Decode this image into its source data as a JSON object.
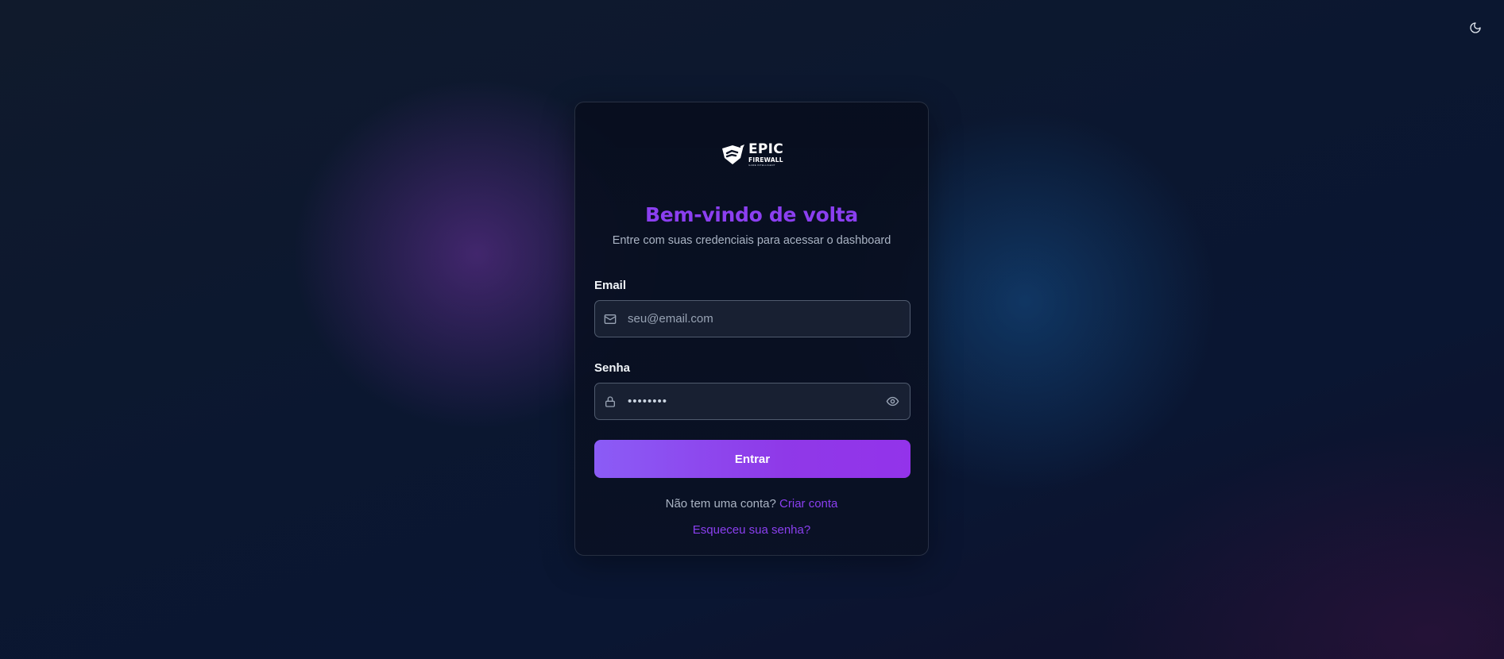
{
  "brand": {
    "name": "EPIC",
    "name_line2": "FIREWALL",
    "tagline": "GAME INTELLIGENT"
  },
  "header": {
    "theme_toggle_icon": "moon-icon"
  },
  "login": {
    "title": "Bem-vindo de volta",
    "subtitle": "Entre com suas credenciais para acessar o dashboard",
    "email": {
      "label": "Email",
      "placeholder": "seu@email.com",
      "value": "",
      "icon": "mail-icon"
    },
    "password": {
      "label": "Senha",
      "value": "••••••••",
      "icon": "lock-icon",
      "toggle_icon": "eye-icon"
    },
    "submit_label": "Entrar",
    "no_account_text": "Não tem uma conta?",
    "create_account_link": "Criar conta",
    "forgot_password_link": "Esqueceu sua senha?"
  },
  "colors": {
    "accent": "#8b3ff0",
    "button_start": "#8b5cf6",
    "button_end": "#9333ea",
    "background": "#0b1428"
  }
}
